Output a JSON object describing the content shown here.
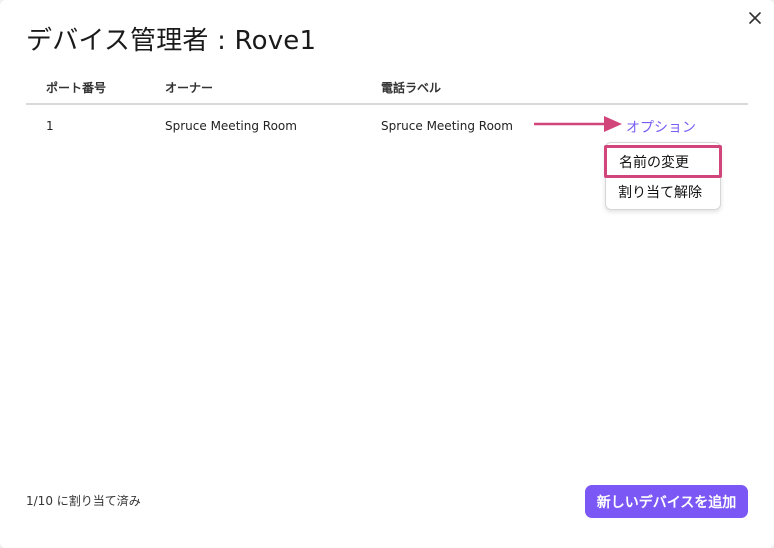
{
  "dialog": {
    "title": "デバイス管理者 : Rove1"
  },
  "table": {
    "headers": [
      "ポート番号",
      "オーナー",
      "電話ラベル"
    ],
    "rows": [
      {
        "port": "1",
        "owner": "Spruce Meeting Room",
        "label": "Spruce Meeting Room"
      }
    ],
    "options_label": "オプション"
  },
  "menu": {
    "items": [
      "名前の変更",
      "割り当て解除"
    ]
  },
  "footer": {
    "count": "1/10 に割り当て済み",
    "add_button": "新しいデバイスを追加"
  },
  "colors": {
    "accent": "#7b57f5",
    "link": "#7a5cf2",
    "annotation": "#d1457a"
  },
  "icons": {
    "close": "close-icon",
    "arrow": "arrow-right-icon"
  }
}
